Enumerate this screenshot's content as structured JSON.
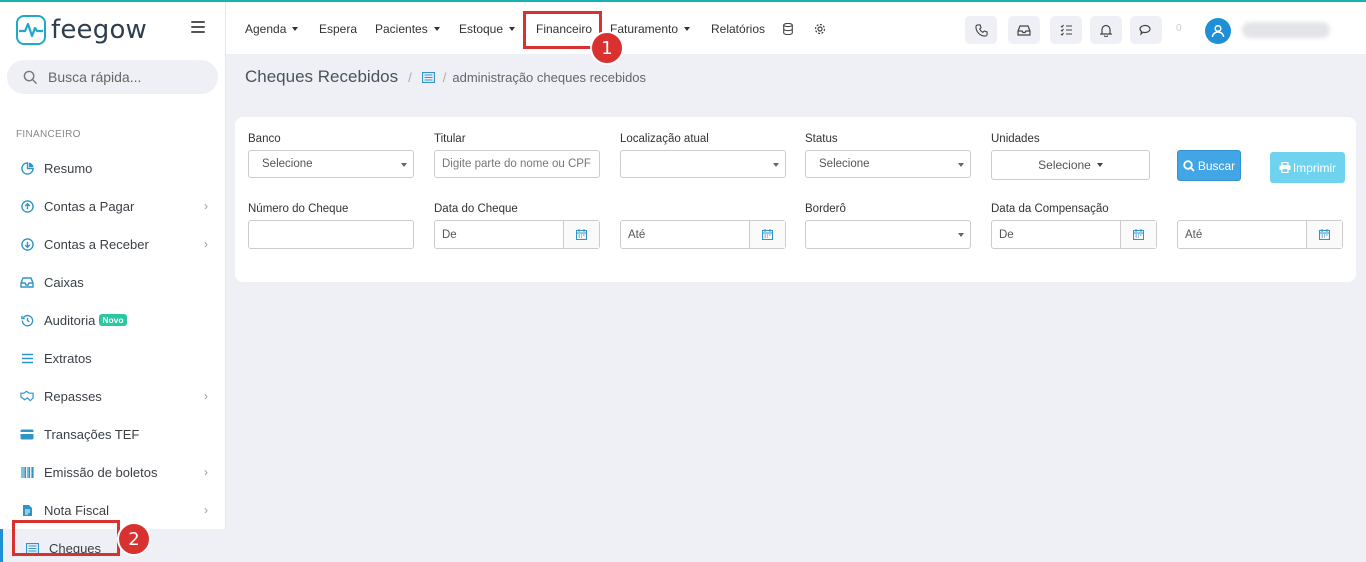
{
  "brand": {
    "name": "feegow",
    "accent": "#1fa8c9"
  },
  "sidebar": {
    "search_placeholder": "Busca rápida...",
    "section_title": "FINANCEIRO",
    "items": [
      {
        "label": "Resumo",
        "icon": "pie-chart-icon",
        "chevron": false
      },
      {
        "label": "Contas a Pagar",
        "icon": "arrow-up-circle-icon",
        "chevron": true
      },
      {
        "label": "Contas a Receber",
        "icon": "arrow-down-circle-icon",
        "chevron": true
      },
      {
        "label": "Caixas",
        "icon": "inbox-icon",
        "chevron": false
      },
      {
        "label": "Auditoria",
        "icon": "history-icon",
        "chevron": false,
        "badge": "Novo"
      },
      {
        "label": "Extratos",
        "icon": "list-icon",
        "chevron": false
      },
      {
        "label": "Repasses",
        "icon": "handshake-icon",
        "chevron": true
      },
      {
        "label": "Transações TEF",
        "icon": "credit-card-icon",
        "chevron": false
      },
      {
        "label": "Emissão de boletos",
        "icon": "barcode-icon",
        "chevron": true
      },
      {
        "label": "Nota Fiscal",
        "icon": "file-icon",
        "chevron": true
      },
      {
        "label": "Cheques",
        "icon": "check-list-icon",
        "chevron": false,
        "active": true
      }
    ]
  },
  "topnav": {
    "items": [
      "Agenda",
      "Espera",
      "Pacientes",
      "Estoque",
      "Financeiro",
      "Faturamento",
      "Relatórios"
    ],
    "count": "0"
  },
  "annotations": {
    "one": "1",
    "two": "2"
  },
  "breadcrumb": {
    "title": "Cheques Recebidos",
    "sub": "administração cheques recebidos"
  },
  "filters": {
    "banco": {
      "label": "Banco",
      "value": "Selecione"
    },
    "titular": {
      "label": "Titular",
      "placeholder": "Digite parte do nome ou CPF"
    },
    "localizacao": {
      "label": "Localização atual",
      "value": ""
    },
    "status": {
      "label": "Status",
      "value": "Selecione"
    },
    "unidades": {
      "label": "Unidades",
      "value": "Selecione"
    },
    "numero": {
      "label": "Número do Cheque",
      "value": ""
    },
    "data_cheque": {
      "label": "Data do Cheque",
      "from": "De",
      "to": "Até"
    },
    "bordero": {
      "label": "Borderô",
      "value": ""
    },
    "data_comp": {
      "label": "Data da Compensação",
      "from": "De",
      "to": "Até"
    }
  },
  "buttons": {
    "buscar": "Buscar",
    "imprimir": "Imprimir"
  }
}
